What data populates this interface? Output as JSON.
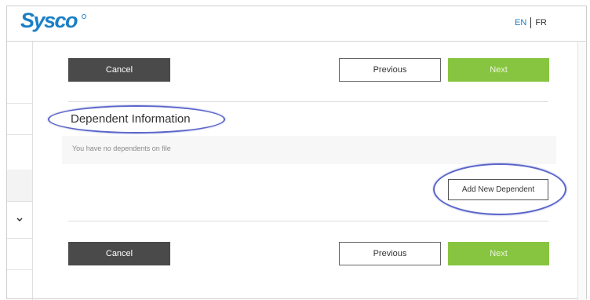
{
  "header": {
    "logo_text": "Sysco",
    "lang_en": "EN",
    "lang_fr": "FR"
  },
  "nav_top": {
    "cancel_label": "Cancel",
    "previous_label": "Previous",
    "next_label": "Next"
  },
  "dependents": {
    "title": "Dependent Information",
    "empty_message": "You have no dependents on file",
    "add_label": "Add New Dependent"
  },
  "nav_bottom": {
    "cancel_label": "Cancel",
    "previous_label": "Previous",
    "next_label": "Next"
  },
  "colors": {
    "brand_blue": "#1a7fc4",
    "next_green": "#87c540",
    "cancel_dark": "#4a4a4a",
    "annotation_ellipse": "#5b66c9"
  },
  "icons": {
    "sidebar_toggle": "chevron-down-icon"
  }
}
